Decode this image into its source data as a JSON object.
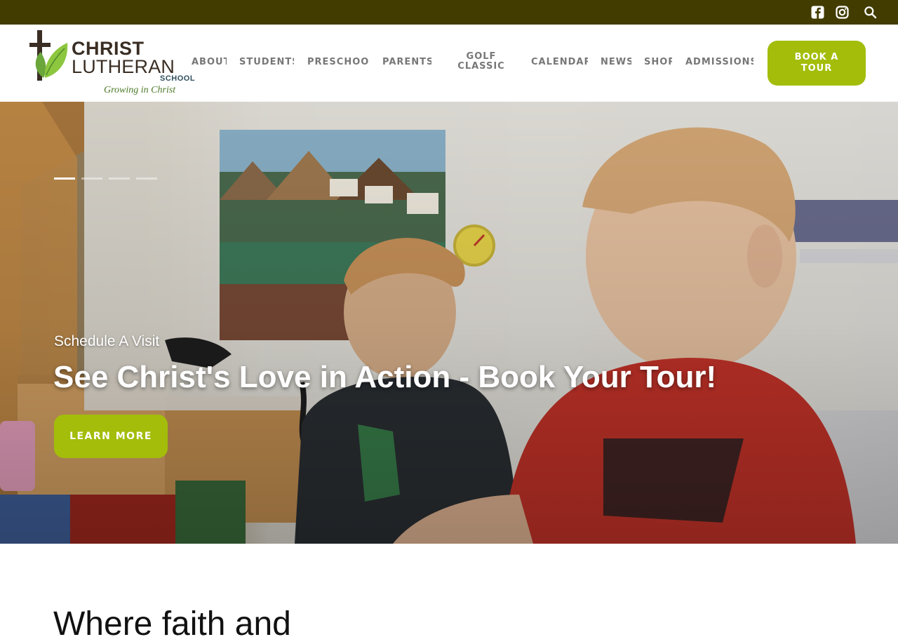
{
  "colors": {
    "topbar_bg": "#423c01",
    "accent_green": "#a3bd0a",
    "nav_text": "#777777"
  },
  "topbar": {
    "icons": [
      "facebook-icon",
      "instagram-icon",
      "search-icon"
    ]
  },
  "logo": {
    "line1": "CHRIST",
    "line2": "LUTHERAN",
    "line3": "SCHOOL",
    "tagline": "Growing in Christ"
  },
  "nav": {
    "items": [
      {
        "label": "ABOUT"
      },
      {
        "label": "STUDENTS"
      },
      {
        "label": "PRESCHOOL"
      },
      {
        "label": "PARENTS"
      },
      {
        "label": "GOLF CLASSIC"
      },
      {
        "label": "CALENDAR"
      },
      {
        "label": "NEWS"
      },
      {
        "label": "SHOP"
      },
      {
        "label": "ADMISSIONS"
      }
    ],
    "cta_label": "BOOK A TOUR"
  },
  "hero": {
    "slide_count": 4,
    "active_slide": 1,
    "kicker": "Schedule A Visit",
    "title": "See Christ's Love in Action - Book Your Tour!",
    "button_label": "LEARN MORE"
  },
  "intro": {
    "heading": "Where faith and"
  }
}
